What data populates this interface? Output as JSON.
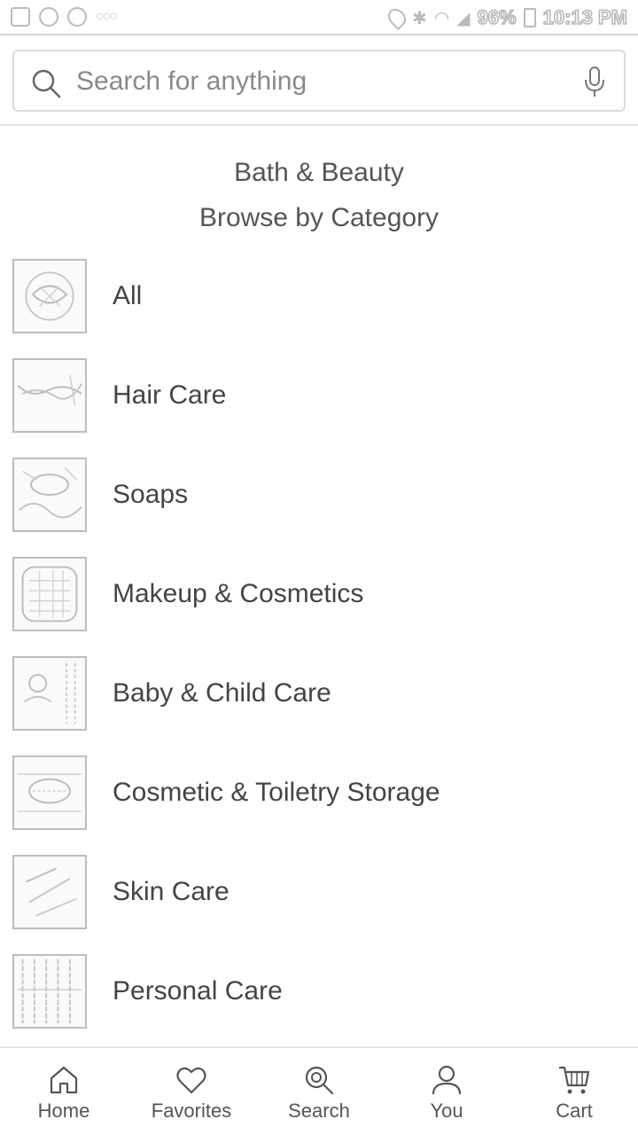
{
  "status_bar": {
    "battery": "96%",
    "time": "10:13 PM"
  },
  "search": {
    "placeholder": "Search for anything",
    "icon": "search-icon",
    "mic_icon": "microphone-icon"
  },
  "header": {
    "title": "Bath & Beauty",
    "subtitle": "Browse by Category"
  },
  "categories": [
    {
      "label": "All"
    },
    {
      "label": "Hair Care"
    },
    {
      "label": "Soaps"
    },
    {
      "label": "Makeup & Cosmetics"
    },
    {
      "label": "Baby & Child Care"
    },
    {
      "label": "Cosmetic & Toiletry Storage"
    },
    {
      "label": "Skin Care"
    },
    {
      "label": "Personal Care"
    }
  ],
  "bottom_nav": [
    {
      "label": "Home",
      "icon": "home-icon"
    },
    {
      "label": "Favorites",
      "icon": "heart-icon"
    },
    {
      "label": "Search",
      "icon": "search-icon"
    },
    {
      "label": "You",
      "icon": "person-icon"
    },
    {
      "label": "Cart",
      "icon": "cart-icon"
    }
  ]
}
